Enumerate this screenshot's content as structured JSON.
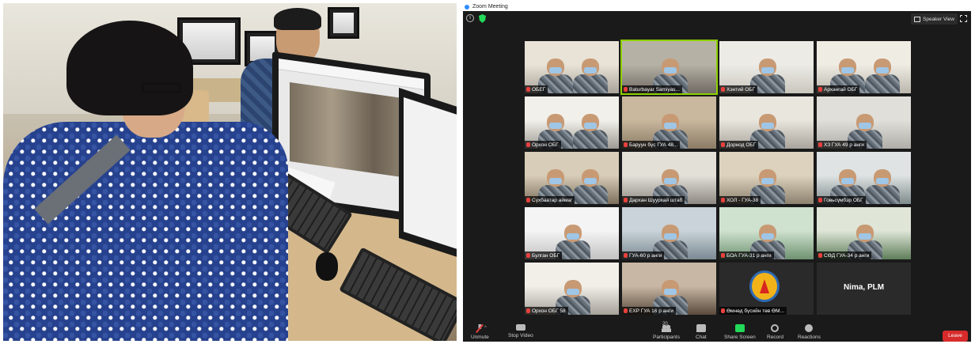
{
  "zoom": {
    "window_title": "Zoom Meeting",
    "view_button": "Speaker View",
    "tiles": [
      {
        "name": "ОБЕГ"
      },
      {
        "name": "Baturbayar Samiyas..."
      },
      {
        "name": "Хэнтий ОБГ"
      },
      {
        "name": "Архангай ОБГ"
      },
      {
        "name": "Орхон ОБГ"
      },
      {
        "name": "Баруун бүс ГУА 48..."
      },
      {
        "name": "Дорнод ОБГ"
      },
      {
        "name": "ХЗ ГУА 49 р анги"
      },
      {
        "name": "Сүхбаатар аймаг"
      },
      {
        "name": "Дархан Шуурхай штаб"
      },
      {
        "name": "ХОЛ - ГУА-38"
      },
      {
        "name": "Говьсүмбэр ОБГ"
      },
      {
        "name": "Булган ОБГ"
      },
      {
        "name": "ГУА-60 р анги"
      },
      {
        "name": "БОА ГУА-31 р анги"
      },
      {
        "name": "СӨД ГУА-34 р анги"
      },
      {
        "name": "Орхон ОБГ 58"
      },
      {
        "name": "ЕХР ГУА 16 р анги"
      },
      {
        "name": "Өмнөд бүсийн төв ӨМ..."
      },
      {
        "name": "Nima, PLM"
      }
    ],
    "controls": {
      "unmute": "Unmute",
      "stop_video": "Stop Video",
      "participants": "Participants",
      "participants_count": "20",
      "chat": "Chat",
      "share_screen": "Share Screen",
      "record": "Record",
      "reactions": "Reactions",
      "leave": "Leave"
    },
    "colors": {
      "active_speaker": "#8ed000",
      "leave": "#d72b2b",
      "share": "#23d959",
      "muted": "#e8413d"
    }
  }
}
